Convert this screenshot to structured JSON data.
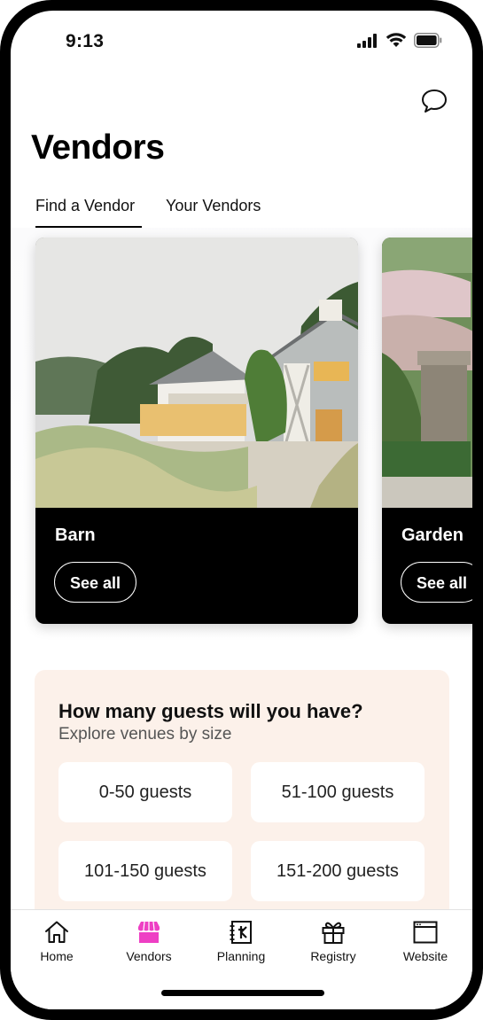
{
  "status_bar": {
    "time": "9:13"
  },
  "header": {
    "title": "Vendors"
  },
  "tabs": [
    {
      "label": "Find a Vendor",
      "active": true
    },
    {
      "label": "Your Vendors",
      "active": false
    }
  ],
  "categories": [
    {
      "title": "Barn",
      "button": "See all"
    },
    {
      "title": "Garden",
      "button": "See all"
    }
  ],
  "guests": {
    "title": "How many guests will you have?",
    "subtitle": "Explore venues by size",
    "options": [
      "0-50 guests",
      "51-100 guests",
      "101-150 guests",
      "151-200 guests"
    ]
  },
  "bottom_nav": [
    {
      "label": "Home",
      "icon": "home-icon"
    },
    {
      "label": "Vendors",
      "icon": "storefront-icon",
      "active": true
    },
    {
      "label": "Planning",
      "icon": "planning-book-icon"
    },
    {
      "label": "Registry",
      "icon": "gift-icon"
    },
    {
      "label": "Website",
      "icon": "browser-window-icon"
    }
  ],
  "colors": {
    "accent": "#ee3fc4",
    "panel": "#fcf1ea",
    "card": "#000000"
  }
}
